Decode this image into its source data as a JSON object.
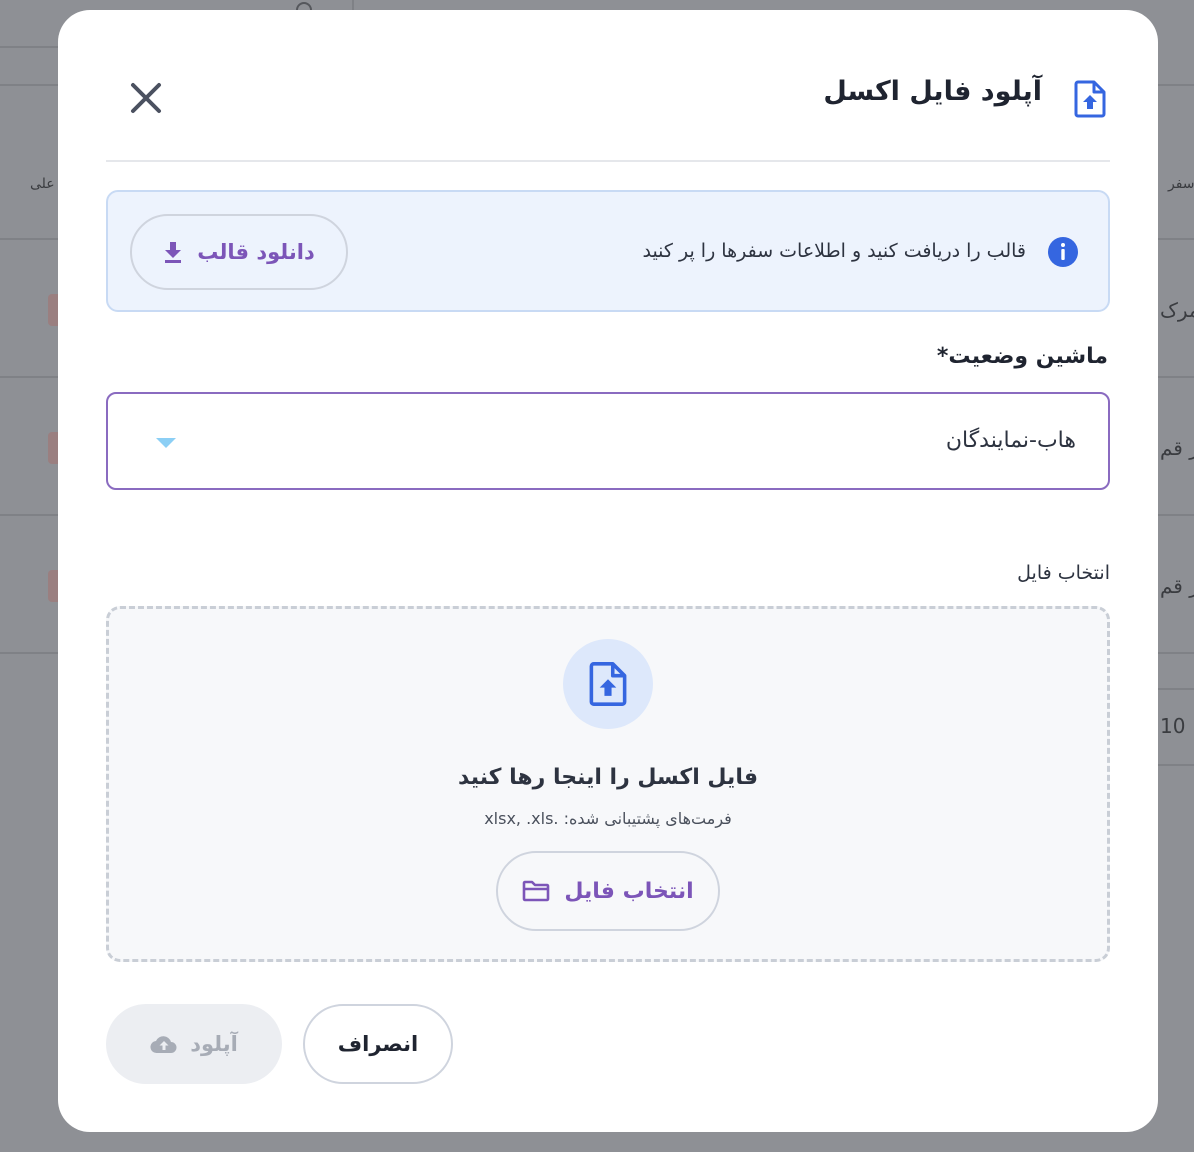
{
  "background": {
    "header_left": "علی",
    "header_right": "سفر",
    "row1": "ز-مرک",
    "row2": "ز قم",
    "row3": "ز قم",
    "page_size": "10"
  },
  "modal": {
    "title": "آپلود فایل اکسل",
    "title_icon": "file-upload-icon",
    "close_icon": "close-icon"
  },
  "info": {
    "text": "قالب را دریافت کنید و اطلاعات سفرها را پر کنید",
    "download_label": "دانلود قالب",
    "icon": "info-icon"
  },
  "status_field": {
    "label": "ماشین وضعیت*",
    "value": "هاب-نمایندگان"
  },
  "file_field": {
    "label": "انتخاب فایل",
    "drop_title": "فایل اکسل را اینجا رها کنید",
    "drop_hint": "فرمت‌های پشتیبانی شده: .xlsx, .xls",
    "choose_label": "انتخاب فایل"
  },
  "actions": {
    "cancel_label": "انصراف",
    "upload_label": "آپلود"
  },
  "colors": {
    "accent_purple": "#7c55b8",
    "accent_blue": "#3566e0",
    "select_border": "#8a6bc0"
  }
}
